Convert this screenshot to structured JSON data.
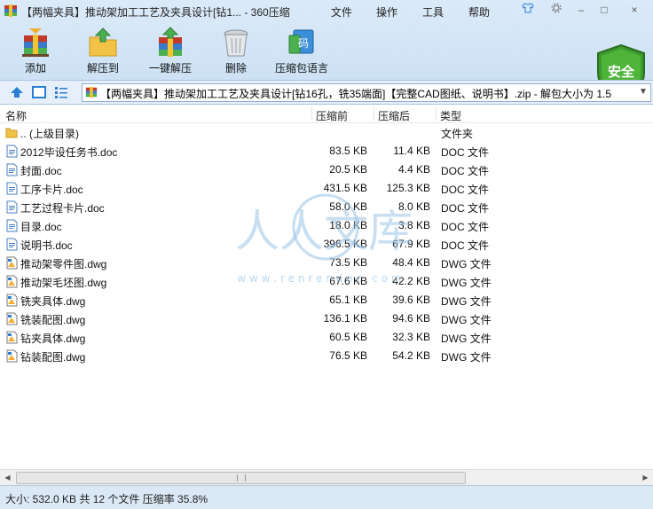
{
  "window": {
    "title": "【两幅夹具】推动架加工工艺及夹具设计[钻1... - 360压缩",
    "menus": [
      "文件",
      "操作",
      "工具",
      "帮助"
    ],
    "controls": {
      "skin": "",
      "minimize": "–",
      "maximize": "□",
      "close": "×"
    }
  },
  "toolbar": {
    "add": "添加",
    "extract": "解压到",
    "oneclick": "一键解压",
    "delete": "删除",
    "encoding": "压缩包语言",
    "encoding_glyph": "码",
    "security": "安全"
  },
  "address": {
    "path": "【两幅夹具】推动架加工工艺及夹具设计[钻16孔，铣35端面]【完整CAD图纸、说明书】.zip - 解包大小为 1.5"
  },
  "columns": {
    "name": "名称",
    "size": "压缩前",
    "csize": "压缩后",
    "type": "类型"
  },
  "files": [
    {
      "name": ".. (上级目录)",
      "size": "",
      "csize": "",
      "type": "文件夹",
      "icon": "folder-icon"
    },
    {
      "name": "2012毕设任务书.doc",
      "size": "83.5 KB",
      "csize": "11.4 KB",
      "type": "DOC 文件",
      "icon": "doc-file-icon"
    },
    {
      "name": "封面.doc",
      "size": "20.5 KB",
      "csize": "4.4 KB",
      "type": "DOC 文件",
      "icon": "doc-file-icon"
    },
    {
      "name": "工序卡片.doc",
      "size": "431.5 KB",
      "csize": "125.3 KB",
      "type": "DOC 文件",
      "icon": "doc-file-icon"
    },
    {
      "name": "工艺过程卡片.doc",
      "size": "58.0 KB",
      "csize": "8.0 KB",
      "type": "DOC 文件",
      "icon": "doc-file-icon"
    },
    {
      "name": "目录.doc",
      "size": "18.0 KB",
      "csize": "3.8 KB",
      "type": "DOC 文件",
      "icon": "doc-file-icon"
    },
    {
      "name": "说明书.doc",
      "size": "396.5 KB",
      "csize": "67.9 KB",
      "type": "DOC 文件",
      "icon": "doc-file-icon"
    },
    {
      "name": "推动架零件图.dwg",
      "size": "73.5 KB",
      "csize": "48.4 KB",
      "type": "DWG 文件",
      "icon": "dwg-file-icon"
    },
    {
      "name": "推动架毛坯图.dwg",
      "size": "67.6 KB",
      "csize": "42.2 KB",
      "type": "DWG 文件",
      "icon": "dwg-file-icon"
    },
    {
      "name": "铣夹具体.dwg",
      "size": "65.1 KB",
      "csize": "39.6 KB",
      "type": "DWG 文件",
      "icon": "dwg-file-icon"
    },
    {
      "name": "铣装配图.dwg",
      "size": "136.1 KB",
      "csize": "94.6 KB",
      "type": "DWG 文件",
      "icon": "dwg-file-icon"
    },
    {
      "name": "钻夹具体.dwg",
      "size": "60.5 KB",
      "csize": "32.3 KB",
      "type": "DWG 文件",
      "icon": "dwg-file-icon"
    },
    {
      "name": "钻装配图.dwg",
      "size": "76.5 KB",
      "csize": "54.2 KB",
      "type": "DWG 文件",
      "icon": "dwg-file-icon"
    }
  ],
  "watermark": {
    "text": "人人文库",
    "url": "w w w . r e n r e n d o c . c o m"
  },
  "status": "大小: 532.0 KB 共 12 个文件 压缩率 35.8%",
  "colors": {
    "accent": "#2a7fd4",
    "shield": "#3e9a2e",
    "watermark": "#9cc6e6"
  }
}
